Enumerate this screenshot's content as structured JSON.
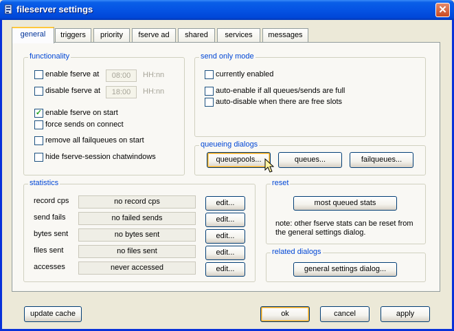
{
  "window": {
    "title": "fileserver settings",
    "close_glyph": "✕"
  },
  "tabs": [
    "general",
    "triggers",
    "priority",
    "fserve ad",
    "shared",
    "services",
    "messages"
  ],
  "functionality": {
    "label": "functionality",
    "enable_at": {
      "label": "enable fserve at",
      "value": "08:00",
      "hint": "HH:nn"
    },
    "disable_at": {
      "label": "disable fserve at",
      "value": "18:00",
      "hint": "HH:nn"
    },
    "enable_on_start": {
      "label": "enable fserve on start",
      "checked": true
    },
    "force_sends": {
      "label": "force sends on connect",
      "checked": false
    },
    "remove_failqueues": {
      "label": "remove all failqueues on start",
      "checked": false
    },
    "hide_chatwindows": {
      "label": "hide fserve-session chatwindows",
      "checked": false
    }
  },
  "send_only": {
    "label": "send only mode",
    "currently_enabled": "currently enabled",
    "auto_enable": "auto-enable if all queues/sends are full",
    "auto_disable": "auto-disable when there are free slots"
  },
  "queueing": {
    "label": "queueing dialogs",
    "queuepools": "queuepools...",
    "queues": "queues...",
    "failqueues": "failqueues..."
  },
  "statistics": {
    "label": "statistics",
    "edit_label": "edit...",
    "rows": [
      {
        "label": "record cps",
        "value": "no record cps"
      },
      {
        "label": "send fails",
        "value": "no failed sends"
      },
      {
        "label": "bytes sent",
        "value": "no bytes sent"
      },
      {
        "label": "files sent",
        "value": "no files sent"
      },
      {
        "label": "accesses",
        "value": "never accessed"
      }
    ]
  },
  "reset": {
    "label": "reset",
    "button": "most queued stats",
    "note_line1": "note: other fserve stats can be reset from",
    "note_line2": "the general settings dialog."
  },
  "related": {
    "label": "related dialogs",
    "button": "general settings dialog..."
  },
  "footer": {
    "update_cache": "update cache",
    "ok": "ok",
    "cancel": "cancel",
    "apply": "apply"
  },
  "colors": {
    "title_bar": "#0553e3",
    "group_label": "#0046d5",
    "tab_highlight": "#ffc83c"
  }
}
